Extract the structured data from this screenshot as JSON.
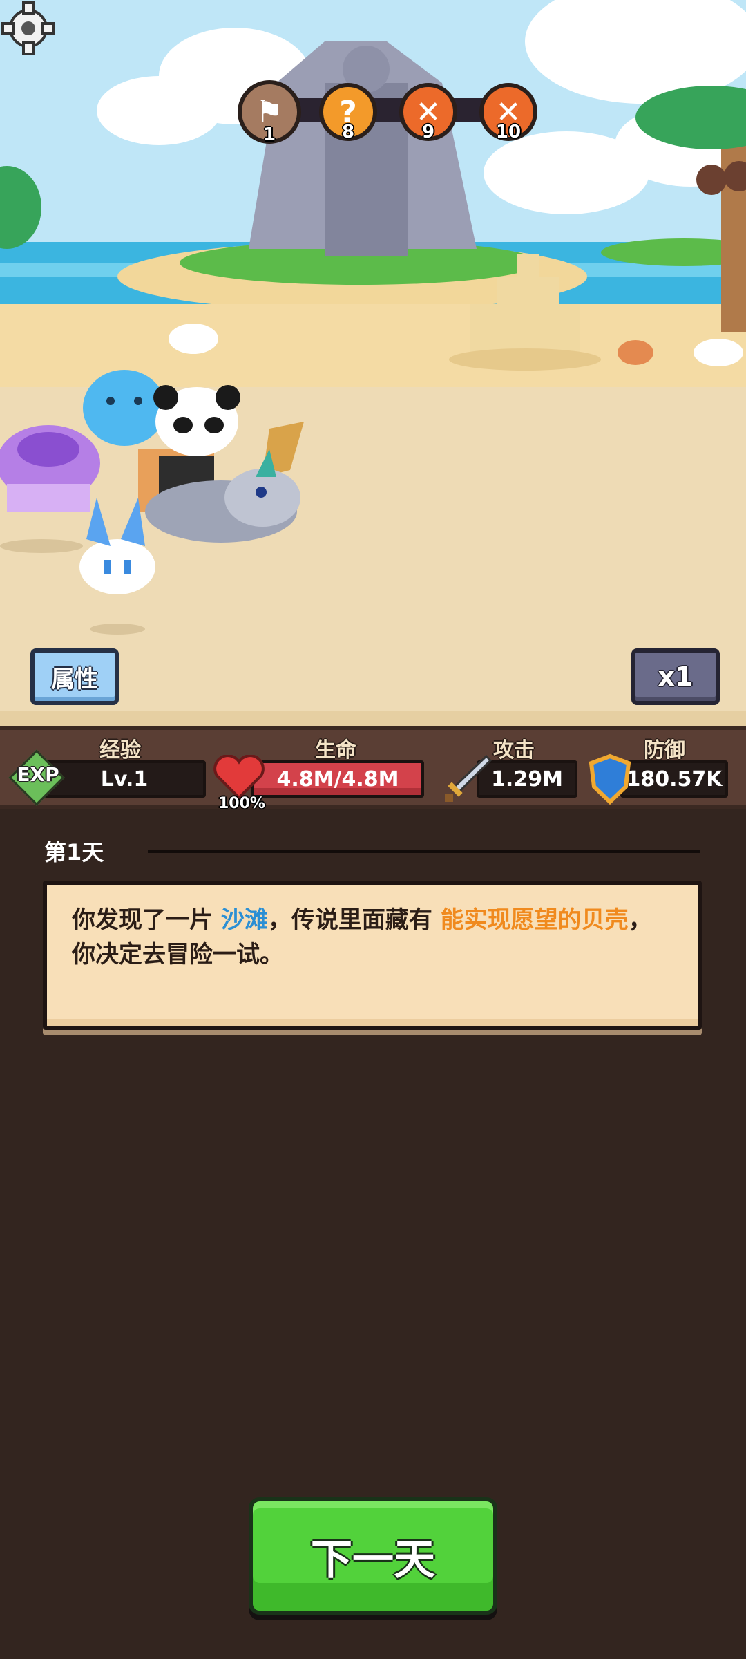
{
  "milestones": [
    {
      "icon": "flag-icon",
      "glyph": "⚑",
      "number": "1",
      "color": "#a57b61"
    },
    {
      "icon": "question-icon",
      "glyph": "?",
      "number": "8",
      "color": "#f39a2a"
    },
    {
      "icon": "crossed-swords-icon",
      "glyph": "✕",
      "number": "9",
      "color": "#ec6a2a"
    },
    {
      "icon": "crossed-swords-icon",
      "glyph": "✕",
      "number": "10",
      "color": "#ec6a2a"
    }
  ],
  "buttons": {
    "attributes": "属性",
    "speed": "x1",
    "next_day": "下一天"
  },
  "stats": {
    "exp": {
      "label": "经验",
      "badge": "EXP",
      "value": "Lv.1"
    },
    "hp": {
      "label": "生命",
      "value": "4.8M/4.8M",
      "percent": "100%"
    },
    "attack": {
      "label": "攻击",
      "value": "1.29M"
    },
    "defense": {
      "label": "防御",
      "value": "180.57K"
    }
  },
  "story": {
    "day": "第1天",
    "part1": "你发现了一片 ",
    "place": "沙滩",
    "part2": "，传说里面藏有 ",
    "item": "能实现愿望的贝壳",
    "part3": "，你决定去冒险一试。"
  },
  "colors": {
    "hp_fill": "#d3424b",
    "next_button": "#52d23b",
    "place_highlight": "#2b8fd4",
    "item_highlight": "#f08a1e"
  }
}
